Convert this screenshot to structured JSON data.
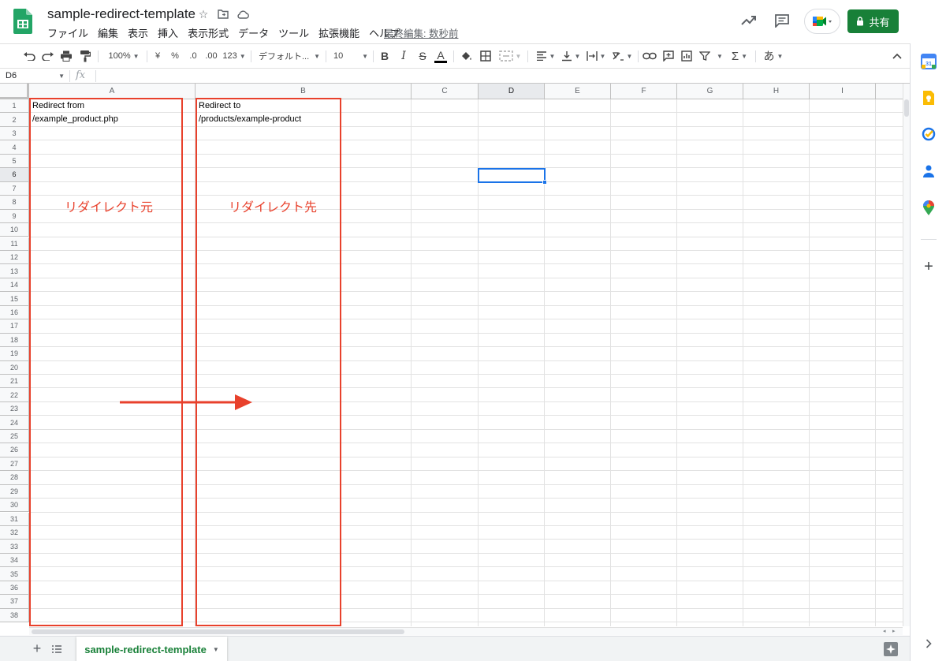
{
  "document": {
    "title": "sample-redirect-template",
    "last_edit": "最終編集: 数秒前"
  },
  "menu": [
    "ファイル",
    "編集",
    "表示",
    "挿入",
    "表示形式",
    "データ",
    "ツール",
    "拡張機能",
    "ヘルプ"
  ],
  "header": {
    "share_label": "共有",
    "icons": [
      "star-icon",
      "move-folder-icon",
      "cloud-status-icon",
      "activity-trend-icon",
      "comments-icon",
      "meet-icon",
      "lock-icon"
    ]
  },
  "toolbar": {
    "zoom": "100%",
    "currency": "¥",
    "percent": "%",
    "decimal_decrease": ".0",
    "decimal_increase": ".00",
    "number_format": "123",
    "font_family": "デフォルト...",
    "font_size": "10",
    "bold": "B",
    "italic": "I",
    "strikethrough": "S",
    "text_color": "A",
    "input_tools": "あ",
    "accent_text_color": "#000000"
  },
  "formula_bar": {
    "cell_ref": "D6",
    "fx": "fx",
    "value": ""
  },
  "grid": {
    "columns": [
      "A",
      "B",
      "C",
      "D",
      "E",
      "F",
      "G",
      "H",
      "I"
    ],
    "rows": [
      "1",
      "2",
      "3",
      "4",
      "5",
      "6",
      "7",
      "8",
      "9",
      "10",
      "11",
      "12",
      "13",
      "14",
      "15",
      "16",
      "17",
      "18",
      "19",
      "20",
      "21",
      "22",
      "23",
      "24",
      "25",
      "26",
      "27",
      "28",
      "29",
      "30",
      "31",
      "32",
      "33",
      "34",
      "35",
      "36",
      "37",
      "38"
    ],
    "selected_cell": "D6",
    "cells": {
      "A1": "Redirect from",
      "A2": "/example_product.php",
      "B1": "Redirect to",
      "B2": "/products/example-product"
    }
  },
  "annotations": {
    "source_label": "リダイレクト元",
    "target_label": "リダイレクト先",
    "color": "#e8412c"
  },
  "sheet_tabs": {
    "active": "sample-redirect-template"
  },
  "side_panel": {
    "icons": [
      "calendar-icon",
      "keep-icon",
      "tasks-icon",
      "contacts-icon",
      "maps-icon",
      "add-addon-icon",
      "expand-panel-icon"
    ]
  },
  "colors": {
    "brand_green": "#188038",
    "selection_blue": "#1a73e8"
  }
}
